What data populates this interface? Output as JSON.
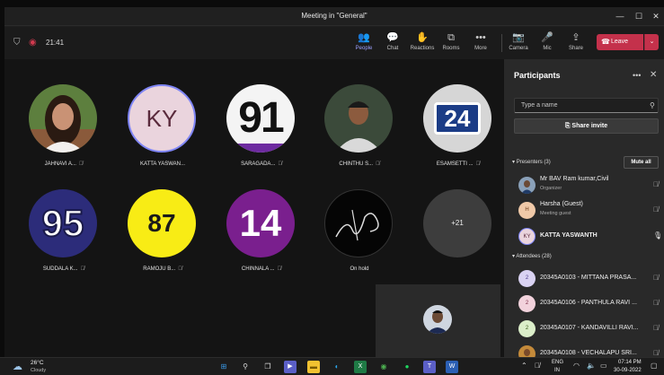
{
  "window": {
    "title": "Meeting in \"General\""
  },
  "toolbar": {
    "timer": "21:41",
    "buttons": [
      "People",
      "Chat",
      "Reactions",
      "Rooms",
      "More",
      "Camera",
      "Mic",
      "Share"
    ],
    "active": "People",
    "leave_label": "Leave"
  },
  "stage": {
    "tiles": [
      {
        "name": "JAHNAVI A...",
        "avatar": "photo-woman",
        "muted": true
      },
      {
        "name": "KATTA YASWAN...",
        "avatar": "initials",
        "initials": "KY",
        "muted": false
      },
      {
        "name": "SARAGADA...",
        "avatar": "number",
        "number": "91",
        "muted": true
      },
      {
        "name": "CHINTHU S...",
        "avatar": "photo-man",
        "muted": true
      },
      {
        "name": "ESAMSETTI ...",
        "avatar": "number",
        "number": "24",
        "muted": true
      },
      {
        "name": "SUDDALA K...",
        "avatar": "number",
        "number": "95",
        "muted": true
      },
      {
        "name": "RAMOJU B...",
        "avatar": "number",
        "number": "87",
        "muted": true
      },
      {
        "name": "CHINNALA ...",
        "avatar": "number",
        "number": "14",
        "muted": true
      },
      {
        "name": "On hold",
        "avatar": "signature",
        "muted": false
      }
    ],
    "overflow_count": "+21"
  },
  "panel": {
    "title": "Participants",
    "search_placeholder": "Type a name",
    "share_invite": "Share invite",
    "presenters_label": "Presenters (3)",
    "mute_all": "Mute all",
    "presenters": [
      {
        "name": "Mr BAV Ram kumar,Civil",
        "role": "Organizer",
        "avatar": "photo"
      },
      {
        "name": "Harsha (Guest)",
        "role": "Meeting guest",
        "initials": "H"
      },
      {
        "name": "KATTA YASWANTH",
        "role": "",
        "initials": "KY"
      }
    ],
    "attendees_label": "Attendees (28)",
    "attendees": [
      {
        "name": "20345A0103 - MITTANA PRASA...",
        "initials": "2"
      },
      {
        "name": "20345A0106 - PANTHULA RAVI ...",
        "initials": "2"
      },
      {
        "name": "20345A0107 - KANDAVILLI RAVI...",
        "initials": "2"
      },
      {
        "name": "20345A0108 - VECHALAPU SRI...",
        "initials": "photo"
      }
    ]
  },
  "taskbar": {
    "weather_temp": "26°C",
    "weather_desc": "Cloudy",
    "lang": "ENG",
    "region": "IN",
    "time": "07:14 PM",
    "date": "30-09-2022"
  },
  "colors": {
    "accent": "#7f85f5",
    "leave": "#c4314b",
    "panel": "#292929",
    "stage": "#141414"
  }
}
